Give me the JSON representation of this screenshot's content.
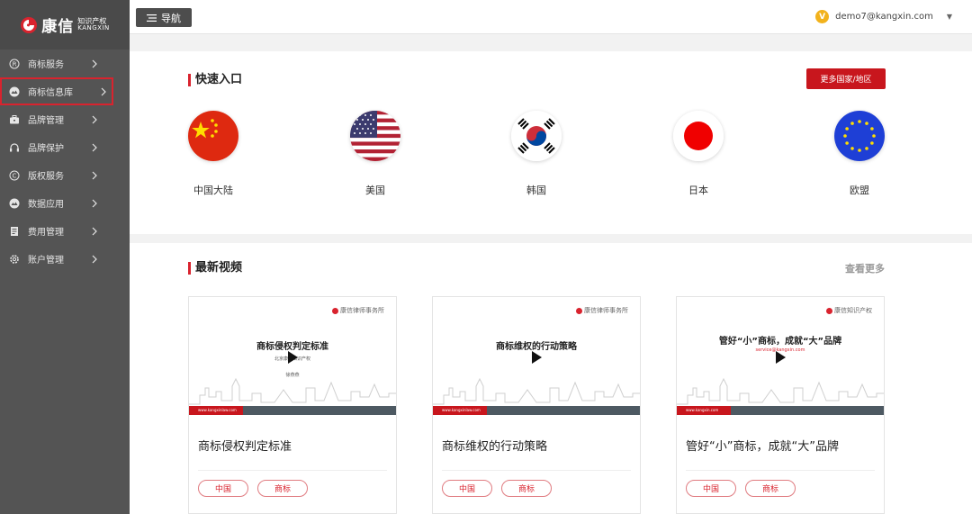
{
  "brand": {
    "name_cn": "康信",
    "sub_cn": "知识产权",
    "sub_en": "KANGXIN",
    "accent": "#d9232e"
  },
  "topbar": {
    "nav_label": "导航",
    "user_email": "demo7@kangxin.com",
    "user_badge": "V"
  },
  "sidebar": {
    "items": [
      {
        "label": "商标服务",
        "icon": "registered-icon"
      },
      {
        "label": "商标信息库",
        "icon": "database-icon",
        "active": true
      },
      {
        "label": "品牌管理",
        "icon": "briefcase-icon"
      },
      {
        "label": "品牌保护",
        "icon": "headset-icon"
      },
      {
        "label": "版权服务",
        "icon": "copyright-icon"
      },
      {
        "label": "数据应用",
        "icon": "data-icon"
      },
      {
        "label": "费用管理",
        "icon": "bill-icon"
      },
      {
        "label": "账户管理",
        "icon": "gear-icon"
      }
    ]
  },
  "quick": {
    "title": "快速入口",
    "more_label": "更多国家/地区",
    "regions": [
      {
        "label": "中国大陆",
        "flag": "china-flag-icon"
      },
      {
        "label": "美国",
        "flag": "usa-flag-icon"
      },
      {
        "label": "韩国",
        "flag": "korea-flag-icon"
      },
      {
        "label": "日本",
        "flag": "japan-flag-icon"
      },
      {
        "label": "欧盟",
        "flag": "eu-flag-icon"
      }
    ]
  },
  "videos": {
    "title": "最新视频",
    "more_label": "查看更多",
    "cards": [
      {
        "thumb_logo": "康信律师事务所",
        "thumb_title": "商标侵权判定标准",
        "thumb_sub": "北京康信知识产权",
        "thumb_sub2": "徐燕燕",
        "thumb_url": "www.kangxinlaw.com",
        "title": "商标侵权判定标准",
        "tags": [
          "中国",
          "商标"
        ]
      },
      {
        "thumb_logo": "康信律师事务所",
        "thumb_title": "商标维权的行动策略",
        "thumb_sub": "",
        "thumb_sub2": "",
        "thumb_url": "www.kangxinlaw.com",
        "title": "商标维权的行动策略",
        "tags": [
          "中国",
          "商标"
        ]
      },
      {
        "thumb_logo": "康信知识产权",
        "thumb_title": "管好“小”商标，成就“大”品牌",
        "thumb_sub": "service@kangxin.com",
        "thumb_sub2": "",
        "thumb_url": "www.kangxin.com",
        "title": "管好“小”商标，成就“大”品牌",
        "tags": [
          "中国",
          "商标"
        ]
      }
    ]
  }
}
